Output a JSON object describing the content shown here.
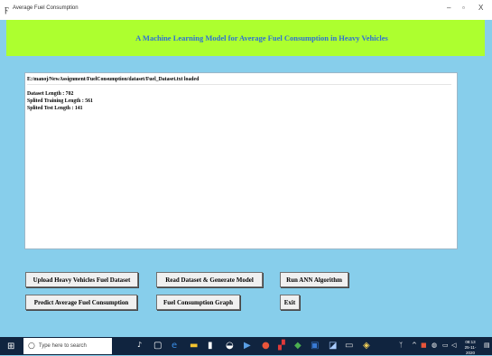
{
  "window": {
    "title": "Average Fuel Consumption",
    "minimize": "–",
    "maximize": "▫",
    "close": "X"
  },
  "header": {
    "title": "A Machine Learning Model for Average Fuel Consumption in Heavy Vehicles",
    "background": "#ADFF2F",
    "title_color": "#2f6fd6"
  },
  "output": {
    "path_line": "E:/manoj/NewAssignment/FuelConsumption/dataset/Fuel_Dataset.txt loaded",
    "lines": [
      "Dataset Length : 702",
      "Splited Training Length : 561",
      "Splited Test Length : 141"
    ]
  },
  "buttons": {
    "upload": "Upload Heavy Vehicles Fuel Dataset",
    "read": "Read Dataset & Generate Model",
    "run": "Run ANN Algorithm",
    "predict": "Predict Average Fuel Consumption",
    "graph": "Fuel Consumption Graph",
    "exit": "Exit"
  },
  "taskbar": {
    "search_placeholder": "Type here to search",
    "time": "08:13",
    "date": "25-11-2020"
  },
  "colors": {
    "background": "#87CEEB",
    "taskbar": "#10243f"
  }
}
